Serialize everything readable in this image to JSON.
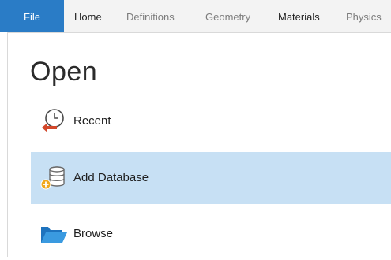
{
  "ribbon": {
    "tabs": [
      {
        "label": "File"
      },
      {
        "label": "Home"
      },
      {
        "label": "Definitions"
      },
      {
        "label": "Geometry"
      },
      {
        "label": "Materials"
      },
      {
        "label": "Physics"
      }
    ]
  },
  "page": {
    "title": "Open",
    "items": [
      {
        "label": "Recent",
        "icon": "recent-clock-icon"
      },
      {
        "label": "Add Database",
        "icon": "add-database-icon"
      },
      {
        "label": "Browse",
        "icon": "folder-icon"
      }
    ]
  },
  "colors": {
    "file_tab": "#2a7cc6",
    "selected_item": "#c7e0f4"
  }
}
